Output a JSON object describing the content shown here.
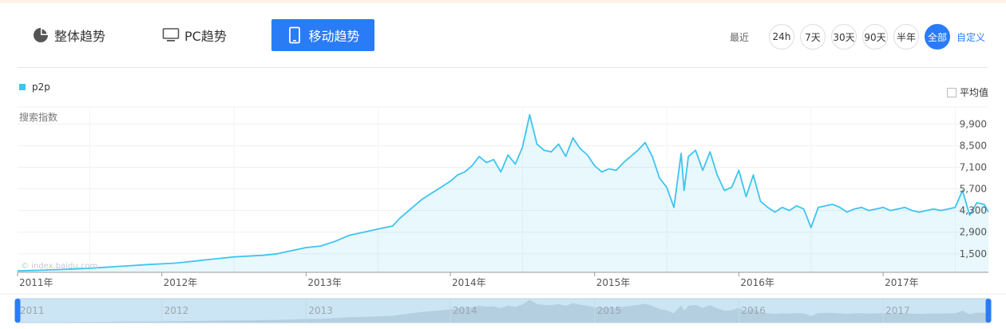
{
  "tabs": [
    {
      "label": "整体趋势",
      "icon": "pie-chart-icon"
    },
    {
      "label": "PC趋势",
      "icon": "monitor-icon"
    },
    {
      "label": "移动趋势",
      "icon": "phone-icon"
    }
  ],
  "range": {
    "label": "最近",
    "options": [
      "24h",
      "7天",
      "30天",
      "90天",
      "半年",
      "全部"
    ],
    "active": "全部",
    "custom": "自定义"
  },
  "legend": {
    "series": "p2p",
    "color": "#3ec4ef"
  },
  "average_label": "平均值",
  "watermark": "© index.baidu.com",
  "chart_data": {
    "type": "area",
    "ylabel": "搜索指数",
    "yticks": [
      1500,
      2900,
      4300,
      5700,
      7100,
      8500,
      9900
    ],
    "ytick_labels": [
      "1,500",
      "2,900",
      "4,300",
      "5,700",
      "7,100",
      "8,500",
      "9,900"
    ],
    "ylim": [
      300,
      11000
    ],
    "xlim": [
      2011.0,
      2017.73
    ],
    "xticks": [
      2011,
      2012,
      2013,
      2014,
      2015,
      2016,
      2017
    ],
    "xtick_labels": [
      "2011年",
      "2012年",
      "2013年",
      "2014年",
      "2015年",
      "2016年",
      "2017年"
    ],
    "navigator_labels": [
      "2011",
      "2012",
      "2013",
      "2014",
      "2015",
      "2016",
      "2017"
    ],
    "series": [
      {
        "name": "p2p",
        "x": [
          2011.0,
          2011.1,
          2011.2,
          2011.3,
          2011.4,
          2011.5,
          2011.6,
          2011.7,
          2011.8,
          2011.9,
          2012.0,
          2012.1,
          2012.2,
          2012.3,
          2012.4,
          2012.5,
          2012.6,
          2012.7,
          2012.8,
          2012.9,
          2013.0,
          2013.1,
          2013.2,
          2013.3,
          2013.4,
          2013.5,
          2013.6,
          2013.65,
          2013.7,
          2013.75,
          2013.8,
          2013.85,
          2013.9,
          2013.95,
          2014.0,
          2014.05,
          2014.1,
          2014.15,
          2014.2,
          2014.25,
          2014.3,
          2014.35,
          2014.4,
          2014.45,
          2014.5,
          2014.55,
          2014.6,
          2014.65,
          2014.7,
          2014.75,
          2014.8,
          2014.85,
          2014.9,
          2014.95,
          2015.0,
          2015.05,
          2015.1,
          2015.15,
          2015.2,
          2015.25,
          2015.3,
          2015.35,
          2015.4,
          2015.45,
          2015.5,
          2015.55,
          2015.6,
          2015.62,
          2015.65,
          2015.7,
          2015.75,
          2015.8,
          2015.85,
          2015.9,
          2015.95,
          2016.0,
          2016.05,
          2016.1,
          2016.15,
          2016.2,
          2016.25,
          2016.3,
          2016.35,
          2016.4,
          2016.45,
          2016.5,
          2016.55,
          2016.6,
          2016.65,
          2016.7,
          2016.75,
          2016.8,
          2016.85,
          2016.9,
          2016.95,
          2017.0,
          2017.05,
          2017.1,
          2017.15,
          2017.2,
          2017.25,
          2017.3,
          2017.35,
          2017.4,
          2017.45,
          2017.5,
          2017.55,
          2017.6,
          2017.65,
          2017.7,
          2017.73
        ],
        "y": [
          400,
          420,
          450,
          480,
          520,
          560,
          620,
          680,
          740,
          800,
          850,
          900,
          1000,
          1100,
          1200,
          1300,
          1350,
          1400,
          1500,
          1700,
          1900,
          2000,
          2300,
          2700,
          2900,
          3100,
          3300,
          3800,
          4200,
          4600,
          5000,
          5300,
          5600,
          5900,
          6200,
          6600,
          6800,
          7200,
          7800,
          7400,
          7600,
          6800,
          7900,
          7300,
          8400,
          10500,
          8600,
          8200,
          8100,
          8600,
          7800,
          9000,
          8300,
          7900,
          7200,
          6800,
          7000,
          6900,
          7400,
          7800,
          8200,
          8700,
          7800,
          6400,
          5800,
          4500,
          8000,
          5600,
          7800,
          8200,
          6900,
          8100,
          6600,
          5600,
          5800,
          6900,
          5200,
          6600,
          4900,
          4500,
          4200,
          4500,
          4300,
          4600,
          4400,
          3200,
          4500,
          4600,
          4700,
          4500,
          4200,
          4400,
          4500,
          4300,
          4400,
          4500,
          4300,
          4400,
          4500,
          4300,
          4200,
          4300,
          4400,
          4300,
          4400,
          4500,
          5600,
          4000,
          4800,
          4700,
          4200
        ]
      }
    ]
  }
}
